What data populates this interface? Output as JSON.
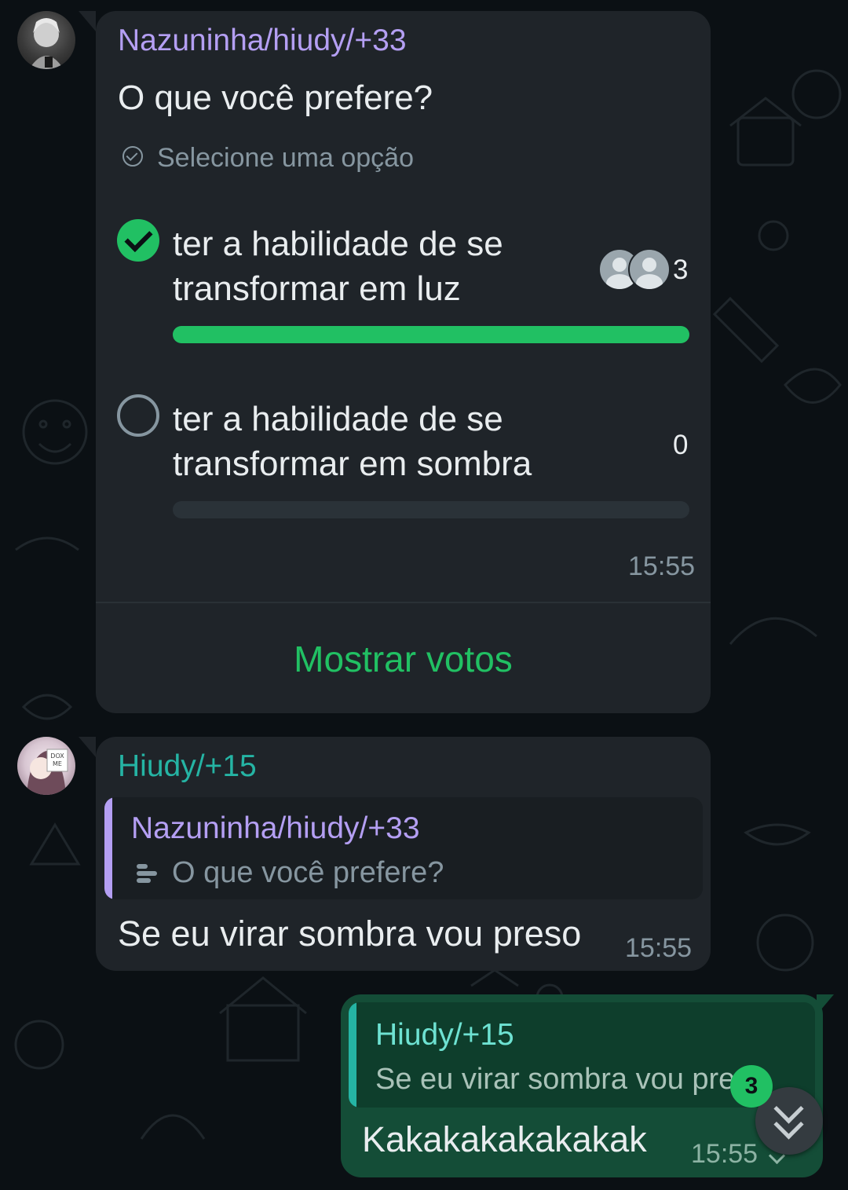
{
  "poll_message": {
    "sender": "Nazuninha/hiudy/+33",
    "question": "O que você prefere?",
    "hint": "Selecione uma opção",
    "options": [
      {
        "label": "ter a habilidade de se transformar em luz",
        "votes": "3",
        "fraction": 1.0,
        "selected": true
      },
      {
        "label": "ter a habilidade de se transformar em sombra",
        "votes": "0",
        "fraction": 0.0,
        "selected": false
      }
    ],
    "time": "15:55",
    "show_votes_label": "Mostrar votos"
  },
  "reply_message": {
    "sender": "Hiudy/+15",
    "quote_sender": "Nazuninha/hiudy/+33",
    "quote_text": "O que você prefere?",
    "text": "Se eu virar sombra vou preso",
    "time": "15:55"
  },
  "own_message": {
    "quote_sender": "Hiudy/+15",
    "quote_text": "Se eu virar sombra vou preso",
    "text": "Kakakakakakakak",
    "time": "15:55"
  },
  "unread_count": "3",
  "colors": {
    "background": "#0b1014",
    "incoming_bubble": "#1f2429",
    "outgoing_bubble": "#144d37",
    "accent_green": "#21c063",
    "sender_purple": "#b49ff3",
    "sender_teal": "#25b4a4"
  },
  "icons": [
    "poll-check-icon",
    "checked-radio-icon",
    "empty-radio-icon",
    "voter-avatar-icon",
    "poll-icon",
    "delivered-tick-icon",
    "scroll-down-icon"
  ]
}
